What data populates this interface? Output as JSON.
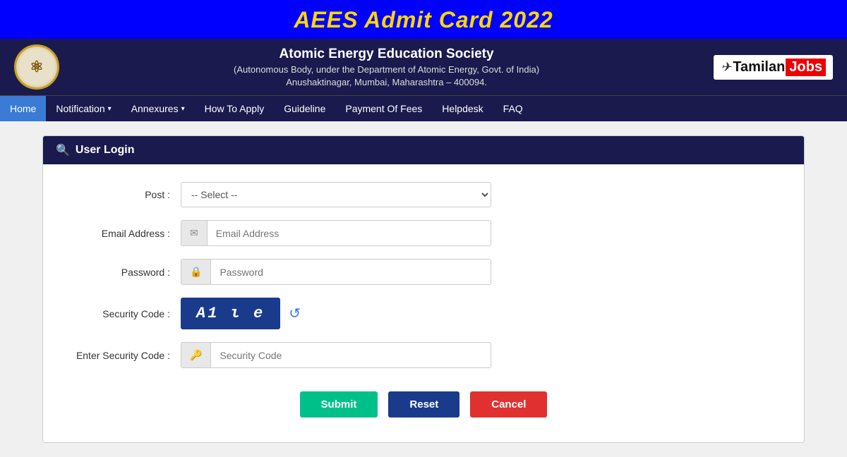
{
  "page": {
    "title": "AEES Admit Card 2022"
  },
  "header": {
    "org_name": "Atomic Energy Education Society",
    "org_sub1": "(Autonomous Body, under the Department of Atomic Energy, Govt. of India)",
    "org_sub2": "Anushaktinagar, Mumbai, Maharashtra – 400094.",
    "logo_symbol": "⚛",
    "brand": "Tamilan Jobs"
  },
  "nav": {
    "items": [
      {
        "label": "Home",
        "active": true,
        "has_dropdown": false
      },
      {
        "label": "Notification",
        "active": false,
        "has_dropdown": true
      },
      {
        "label": "Annexures",
        "active": false,
        "has_dropdown": true
      },
      {
        "label": "How To Apply",
        "active": false,
        "has_dropdown": false
      },
      {
        "label": "Guideline",
        "active": false,
        "has_dropdown": false
      },
      {
        "label": "Payment Of Fees",
        "active": false,
        "has_dropdown": false
      },
      {
        "label": "Helpdesk",
        "active": false,
        "has_dropdown": false
      },
      {
        "label": "FAQ",
        "active": false,
        "has_dropdown": false
      }
    ]
  },
  "login_card": {
    "header_icon": "🔍",
    "header_label": "User Login",
    "fields": {
      "post": {
        "label": "Post :",
        "placeholder": "-- Select --",
        "options": [
          "-- Select --"
        ]
      },
      "email": {
        "label": "Email Address :",
        "placeholder": "Email Address",
        "icon": "✉"
      },
      "password": {
        "label": "Password :",
        "placeholder": "Password",
        "icon": "🔒"
      },
      "security_code_display": {
        "label": "Security Code :",
        "captcha_text": "A1 ι e",
        "refresh_icon": "↺"
      },
      "security_code_input": {
        "label": "Enter Security Code :",
        "placeholder": "Security Code",
        "icon": "🔑"
      }
    },
    "buttons": {
      "submit": "Submit",
      "reset": "Reset",
      "cancel": "Cancel"
    }
  }
}
